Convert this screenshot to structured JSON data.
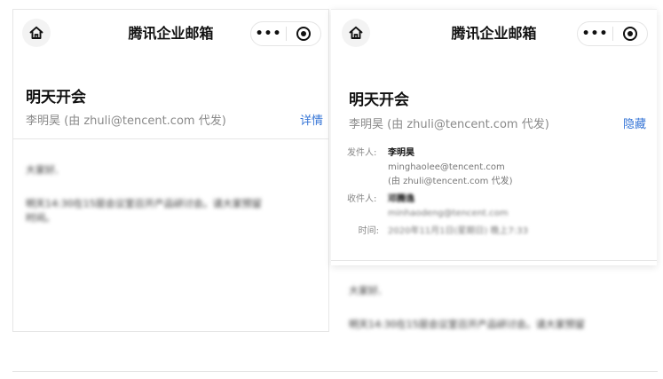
{
  "left": {
    "nav_title": "腾讯企业邮箱",
    "more_label": "•••",
    "subject": "明天开会",
    "sender_line": "李明昊 (由 zhuli@tencent.com 代发)",
    "action_label": "详情",
    "body_lines": [
      "大家好,",
      "明天14:30在15层会议室召开产品研讨会。请大家预留",
      "时间。"
    ]
  },
  "right": {
    "nav_title": "腾讯企业邮箱",
    "more_label": "•••",
    "subject": "明天开会",
    "sender_line": "李明昊 (由 zhuli@tencent.com 代发)",
    "action_label": "隐藏",
    "from_label": "发件人:",
    "from_name": "李明昊",
    "from_email": "minghaolee@tencent.com",
    "from_proxy": "(由 zhuli@tencent.com 代发)",
    "to_label": "收件人:",
    "to_name": "邓腾逸",
    "to_email": "minhaodeng@tencent.com",
    "time_label": "时间:",
    "time_value": "2020年11月1日(星期日) 晚上7:33",
    "body_lines": [
      "大家好,",
      "明天14:30在15层会议室召开产品研讨会。请大家预留"
    ]
  },
  "icons": {
    "home": "home-icon",
    "more": "more-dots-icon",
    "target": "close-target-icon"
  }
}
